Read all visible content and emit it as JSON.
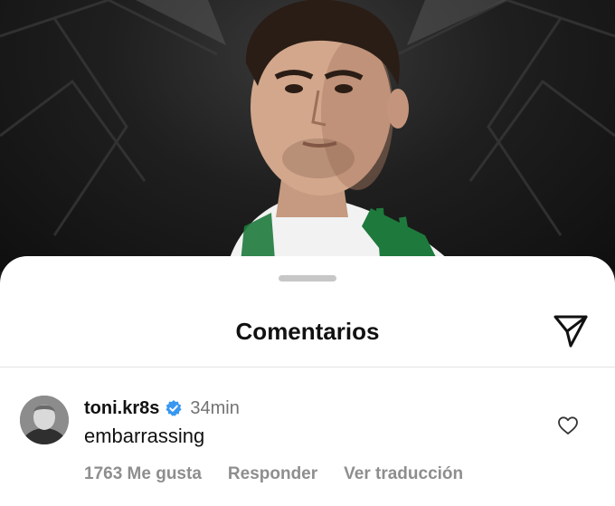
{
  "sheet": {
    "title": "Comentarios"
  },
  "comment": {
    "username": "toni.kr8s",
    "time": "34min",
    "text": "embarrassing",
    "likes_label": "1763 Me gusta",
    "reply_label": "Responder",
    "translate_label": "Ver traducción",
    "verified": true
  },
  "icons": {
    "send": "send-paper-plane-icon",
    "heart": "heart-outline-icon",
    "verified": "verified-badge-icon"
  },
  "colors": {
    "verified_blue": "#3897f0",
    "muted_text": "#8e8e8e",
    "jersey_green": "#1e7a3c"
  }
}
